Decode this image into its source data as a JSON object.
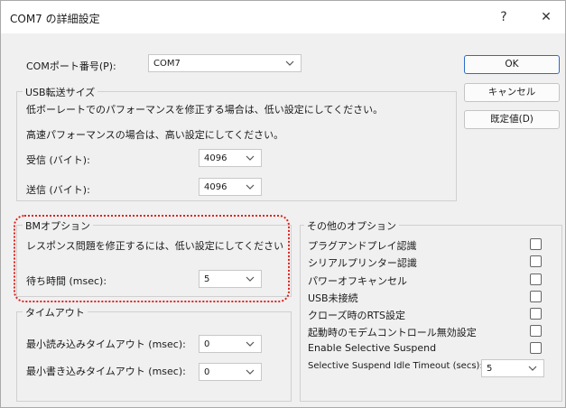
{
  "window": {
    "title": "COM7 の詳細設定",
    "help": "?",
    "close": "✕"
  },
  "port": {
    "label": "COMポート番号(P):",
    "value": "COM7"
  },
  "buttons": {
    "ok": "OK",
    "cancel": "キャンセル",
    "defaults": "既定値(D)"
  },
  "usb": {
    "title": "USB転送サイズ",
    "desc1": "低ボーレートでのパフォーマンスを修正する場合は、低い設定にしてください。",
    "desc2": "高速パフォーマンスの場合は、高い設定にしてください。",
    "receive_label": "受信 (バイト):",
    "receive_value": "4096",
    "send_label": "送信 (バイト):",
    "send_value": "4096"
  },
  "bm": {
    "title": "BMオプション",
    "desc": "レスポンス問題を修正するには、低い設定にしてください",
    "latency_label": "待ち時間 (msec):",
    "latency_value": "5"
  },
  "timeouts": {
    "title": "タイムアウト",
    "read_label": "最小読み込みタイムアウト (msec):",
    "read_value": "0",
    "write_label": "最小書き込みタイムアウト (msec):",
    "write_value": "0"
  },
  "misc": {
    "title": "その他のオプション",
    "options": [
      "プラグアンドプレイ認識",
      "シリアルプリンター認識",
      "パワーオフキャンセル",
      "USB未接続",
      "クローズ時のRTS設定",
      "起動時のモデムコントロール無効設定",
      "Enable Selective Suspend"
    ],
    "idle_label": "Selective Suspend Idle Timeout (secs):",
    "idle_value": "5"
  }
}
